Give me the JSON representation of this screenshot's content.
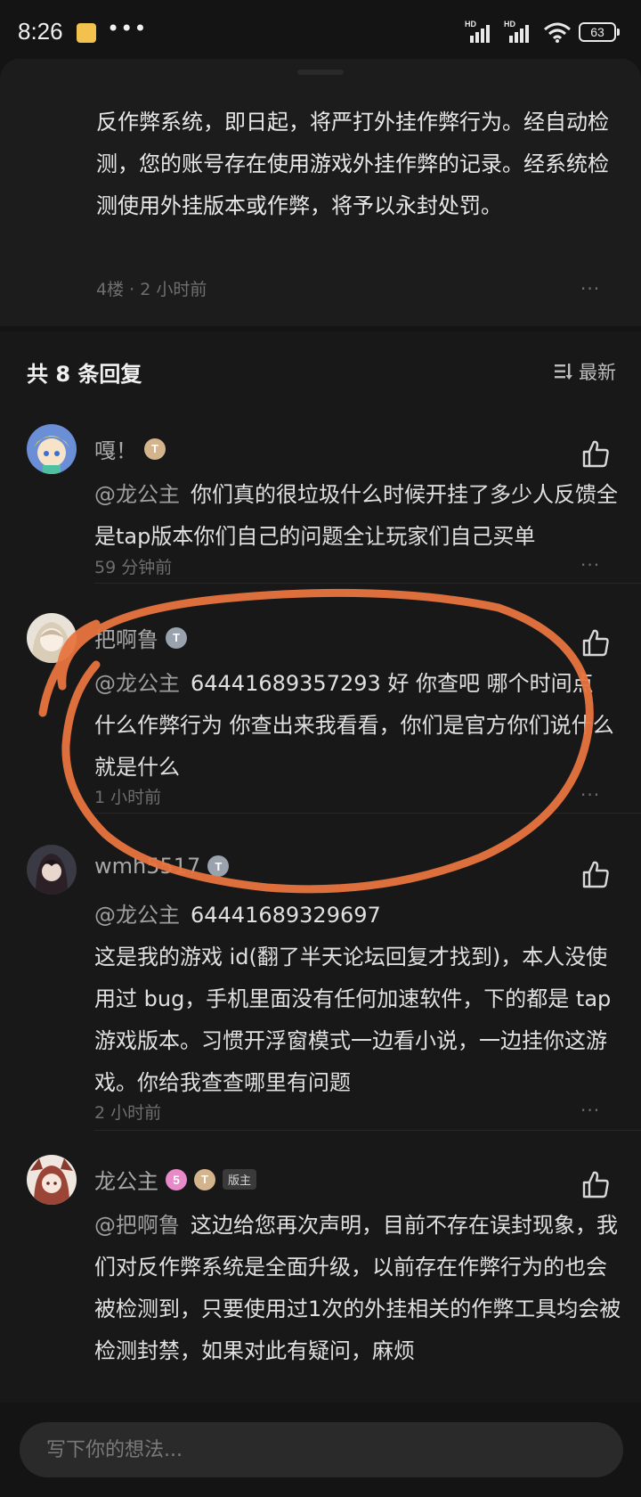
{
  "status_bar": {
    "time": "8:26",
    "network_1": "HD",
    "network_2": "HD",
    "battery": "63"
  },
  "post": {
    "text": "反作弊系统，即日起，将严打外挂作弊行为。经自动检测，您的账号存在使用游戏外挂作弊的记录。经系统检测使用外挂版本或作弊，将予以永封处罚。",
    "meta": "4楼 · 2 小时前",
    "more": "···"
  },
  "replies": {
    "title": "共 8 条回复",
    "sort_label": "最新",
    "items": [
      {
        "name": "嘎！",
        "badge": "T",
        "mention": "@龙公主",
        "text": "你们真的很垃圾什么时候开挂了多少人反馈全是tap版本你们自己的问题全让玩家们自己买单",
        "time": "59 分钟前",
        "more": "···"
      },
      {
        "name": "把啊鲁",
        "badge": "T",
        "mention": "@龙公主",
        "text": "64441689357293  好 你查吧   哪个时间点  什么作弊行为  你查出来我看看，你们是官方你们说什么就是什么",
        "time": "1 小时前",
        "more": "···"
      },
      {
        "name": "wmh5517",
        "badge": "T",
        "mention": "@龙公主",
        "text": "64441689329697\n这是我的游戏 id(翻了半天论坛回复才找到)，本人没使用过 bug，手机里面没有任何加速软件，下的都是 tap 游戏版本。习惯开浮窗模式一边看小说，一边挂你这游戏。你给我查查哪里有问题",
        "time": "2 小时前",
        "more": "···"
      },
      {
        "name": "龙公主",
        "level_badge": "5",
        "badge": "T",
        "role_badge": "版主",
        "mention": "@把啊鲁",
        "text": "这边给您再次声明，目前不存在误封现象，我们对反作弊系统是全面升级，以前存在作弊行为的也会被检测到，只要使用过1次的外挂相关的作弊工具均会被检测封禁，如果对此有疑问，麻烦"
      }
    ]
  },
  "input": {
    "placeholder": "写下你的想法..."
  },
  "colors": {
    "background": "#141414",
    "panel": "#181818",
    "annotation_circle": "#e8743f"
  }
}
